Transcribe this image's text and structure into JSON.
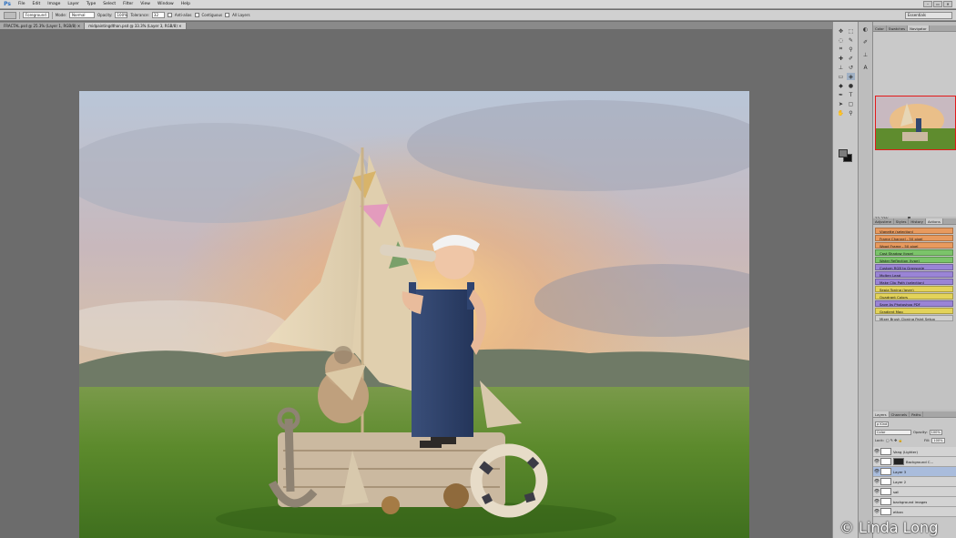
{
  "app": {
    "logo": "Ps"
  },
  "menubar": {
    "items": [
      "File",
      "Edit",
      "Image",
      "Layer",
      "Type",
      "Select",
      "Filter",
      "View",
      "Window",
      "Help"
    ],
    "window_controls": [
      "–",
      "▭",
      "✕"
    ]
  },
  "options_bar": {
    "fill_source": "Foreground",
    "mode_label": "Mode:",
    "mode_value": "Normal",
    "opacity_label": "Opacity:",
    "opacity_value": "100%",
    "tolerance_label": "Tolerance:",
    "tolerance_value": "32",
    "anti_alias_label": "Anti-alias",
    "contiguous_label": "Contiguous",
    "all_layers_label": "All Layers",
    "workspace": "Essentials"
  },
  "document_tabs": [
    {
      "label": "FRACTAL.psd @ 25.3% (Layer 1, RGB/8) ✕",
      "active": false
    },
    {
      "label": "midpaintingdthan.psd @ 33.3% (Layer 3, RGB/8) ✕",
      "active": true
    }
  ],
  "navigator": {
    "tabs": [
      "Color",
      "Swatches",
      "Navigator"
    ],
    "zoom": "33.33%",
    "box_color": "#e21a1a"
  },
  "actions": {
    "tabs": [
      "Adjustme",
      "Styles",
      "History",
      "Actions"
    ],
    "items": [
      {
        "label": "Vignette (selection)",
        "color": "#e89a5e"
      },
      {
        "label": "Frame Channel - 50 pixel",
        "color": "#e89a5e"
      },
      {
        "label": "Wood Frame - 50 pixel",
        "color": "#e89a5e"
      },
      {
        "label": "Cast Shadow (type)",
        "color": "#7bc46a"
      },
      {
        "label": "Water Reflection (type)",
        "color": "#7bc46a"
      },
      {
        "label": "Custom RGB to Grayscale",
        "color": "#9a84d6"
      },
      {
        "label": "Molten Lead",
        "color": "#9a84d6"
      },
      {
        "label": "Make Clip Path (selection)",
        "color": "#9a84d6"
      },
      {
        "label": "Sepia Toning (layer)",
        "color": "#e3d35a"
      },
      {
        "label": "Quadrant Colors",
        "color": "#e3d35a"
      },
      {
        "label": "Save As Photoshop PDF",
        "color": "#9a84d6"
      },
      {
        "label": "Gradient Map",
        "color": "#e3d35a"
      },
      {
        "label": "Mixer Brush Cloning Paint Setup",
        "color": "#d0d0d0"
      }
    ]
  },
  "layers": {
    "tabs": [
      "Layers",
      "Channels",
      "Paths"
    ],
    "kind_label": "ρ Kind",
    "blend_mode": "Color",
    "opacity_label": "Opacity:",
    "opacity_value": "100%",
    "lock_label": "Lock:",
    "fill_label": "Fill:",
    "fill_value": "100%",
    "items": [
      {
        "name": "Vang (Lighter)",
        "selected": false,
        "mask": false
      },
      {
        "name": "Background C...",
        "selected": false,
        "mask": true
      },
      {
        "name": "Layer 3",
        "selected": true,
        "mask": false
      },
      {
        "name": "Layer 2",
        "selected": false,
        "mask": false
      },
      {
        "name": "sail",
        "selected": false,
        "mask": false
      },
      {
        "name": "background images",
        "selected": false,
        "mask": false
      },
      {
        "name": "ethan",
        "selected": false,
        "mask": false
      }
    ]
  },
  "tools": [
    "move-tool",
    "marquee-tool",
    "lasso-tool",
    "quick-select-tool",
    "crop-tool",
    "eyedropper-tool",
    "healing-tool",
    "brush-tool",
    "clone-stamp-tool",
    "history-brush-tool",
    "eraser-tool",
    "paint-bucket-tool",
    "blur-tool",
    "dodge-tool",
    "pen-tool",
    "type-tool",
    "path-select-tool",
    "shape-tool",
    "hand-tool",
    "zoom-tool"
  ],
  "watermark": "© Linda Long"
}
